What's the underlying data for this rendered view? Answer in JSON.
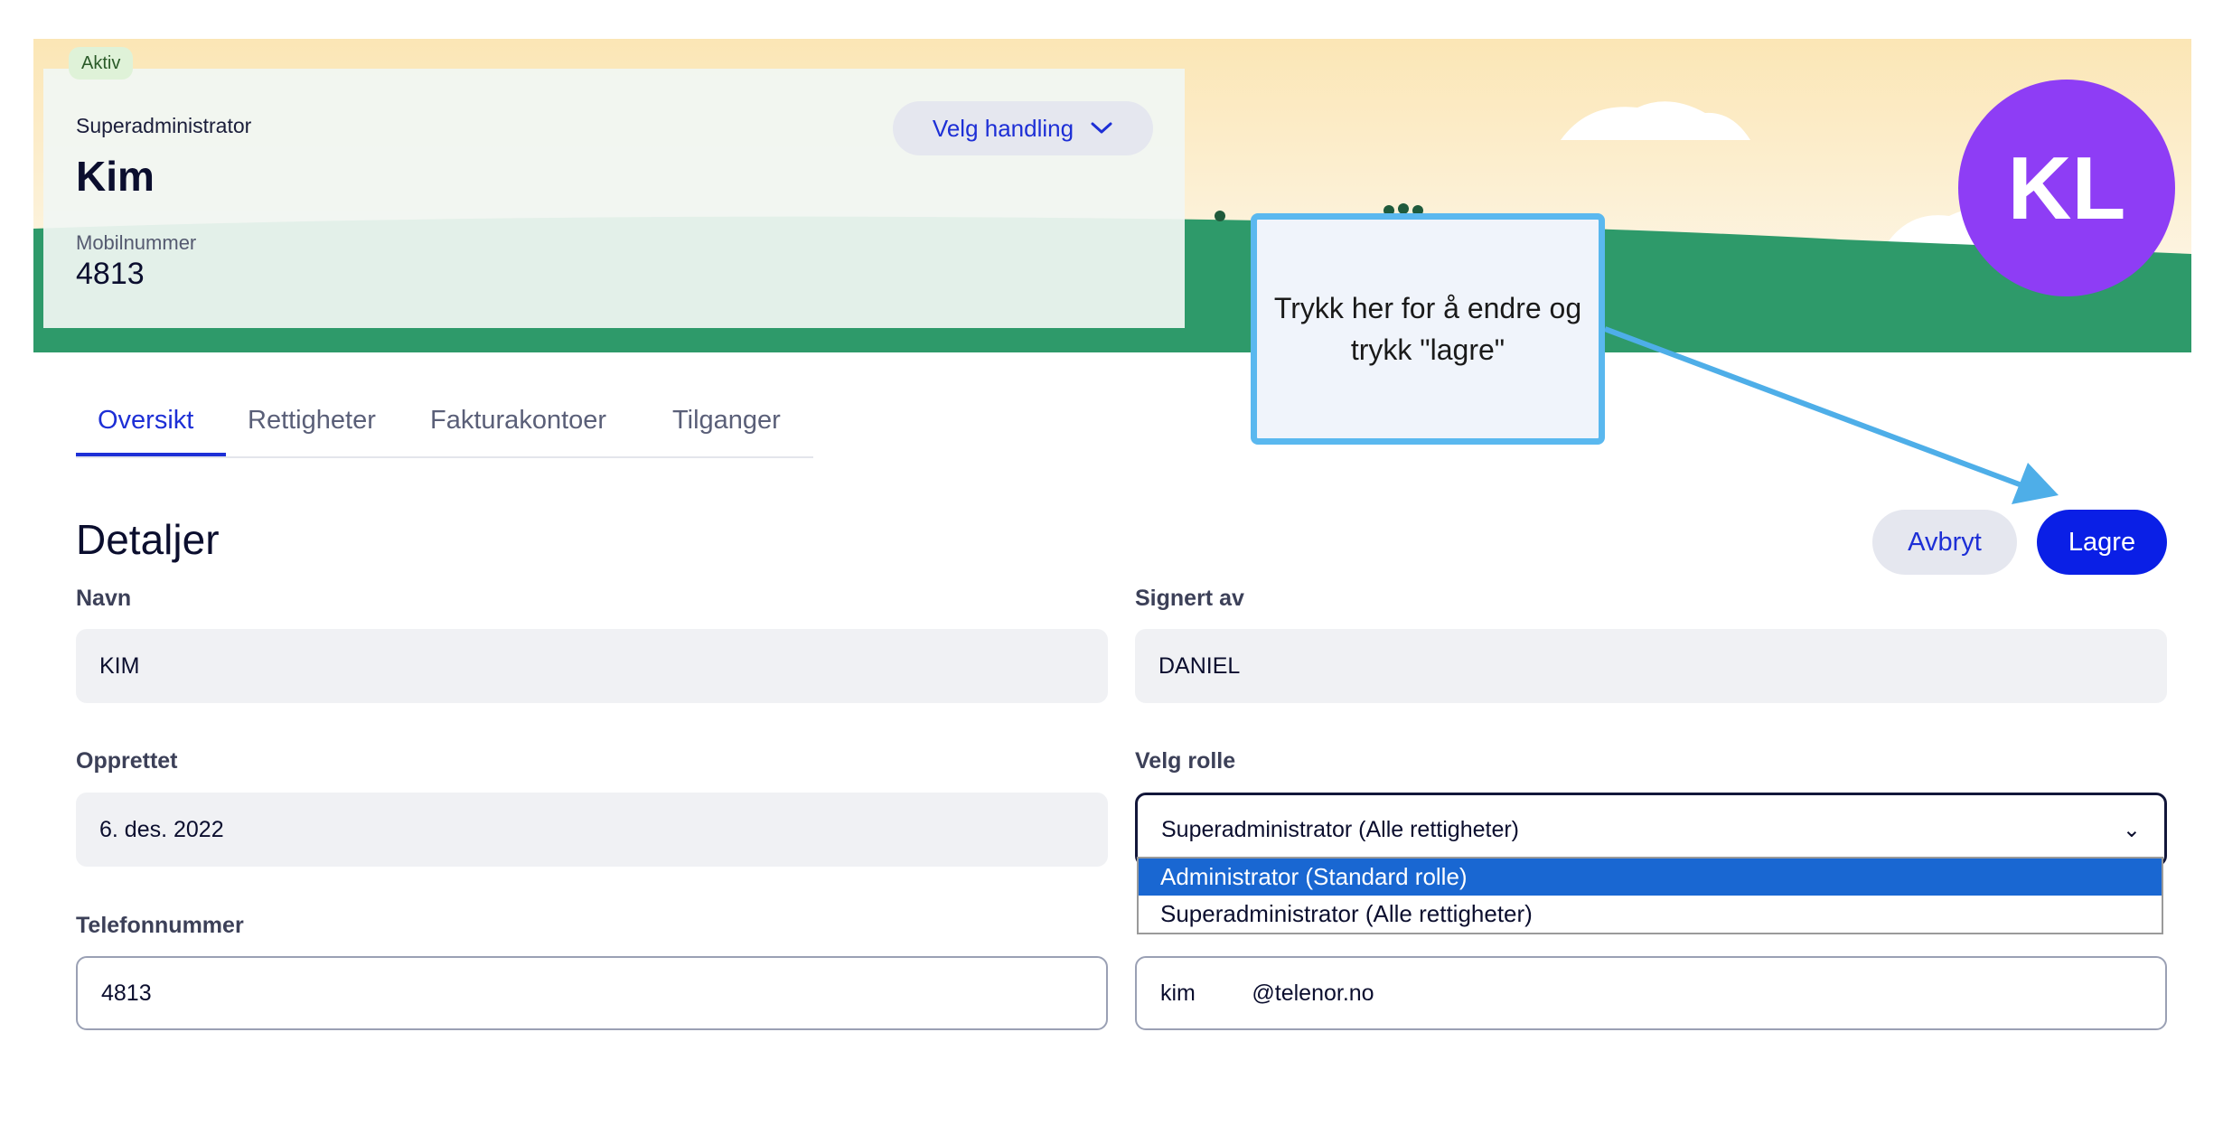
{
  "header": {
    "status_badge": "Aktiv",
    "role": "Superadministrator",
    "name": "Kim",
    "mobile_label": "Mobilnummer",
    "mobile_value": "4813",
    "action_button_label": "Velg handling",
    "avatar_initials": "KL"
  },
  "tabs": [
    {
      "label": "Oversikt",
      "active": true
    },
    {
      "label": "Rettigheter",
      "active": false
    },
    {
      "label": "Fakturakontoer",
      "active": false
    },
    {
      "label": "Tilganger",
      "active": false
    }
  ],
  "details": {
    "title": "Detaljer",
    "cancel_label": "Avbryt",
    "save_label": "Lagre",
    "fields": {
      "name_label": "Navn",
      "name_value": "KIM",
      "signed_by_label": "Signert av",
      "signed_by_value": "DANIEL",
      "created_label": "Opprettet",
      "created_value": "6. des. 2022",
      "role_label": "Velg rolle",
      "role_value": "Superadministrator (Alle rettigheter)",
      "phone_label": "Telefonnummer",
      "phone_value": "4813",
      "email_value": "kim         @telenor.no"
    },
    "role_options": [
      {
        "label": "Administrator (Standard rolle)",
        "highlighted": true
      },
      {
        "label": "Superadministrator (Alle rettigheter)",
        "highlighted": false
      }
    ]
  },
  "callout": {
    "text": "Trykk her for å endre og trykk \"lagre\""
  },
  "colors": {
    "accent": "#1d2fd6",
    "primary_button": "#0a1fe6",
    "avatar": "#8e3df5",
    "banner_green": "#2e9a6a",
    "callout_border": "#5ab8ef",
    "dropdown_highlight": "#1967d2"
  }
}
